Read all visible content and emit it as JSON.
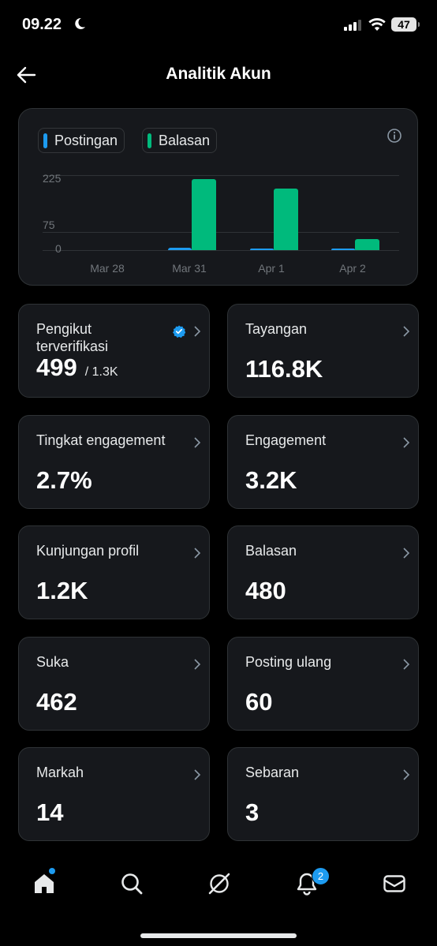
{
  "status_bar": {
    "time": "09.22",
    "battery": "47"
  },
  "header": {
    "title": "Analitik Akun"
  },
  "chart_data": {
    "type": "bar",
    "categories": [
      "Mar 28",
      "Mar 31",
      "Apr 1",
      "Apr 2"
    ],
    "series": [
      {
        "name": "Postingan",
        "values": [
          0,
          7,
          6,
          1
        ]
      },
      {
        "name": "Balasan",
        "values": [
          0,
          220,
          190,
          35
        ]
      }
    ],
    "y_ticks": [
      "225",
      "75",
      "0"
    ],
    "ylim": [
      0,
      225
    ],
    "colors": {
      "Postingan": "#1d9bf0",
      "Balasan": "#00ba7c"
    }
  },
  "legend": {
    "posts": "Postingan",
    "replies": "Balasan"
  },
  "stats": {
    "verified_followers": {
      "label": "Pengikut terverifikasi",
      "value": "499",
      "total": "/ 1.3K"
    },
    "impressions": {
      "label": "Tayangan",
      "value": "116.8K"
    },
    "engagement_rate": {
      "label": "Tingkat engagement",
      "value": "2.7%"
    },
    "engagements": {
      "label": "Engagement",
      "value": "3.2K"
    },
    "profile_visits": {
      "label": "Kunjungan profil",
      "value": "1.2K"
    },
    "replies": {
      "label": "Balasan",
      "value": "480"
    },
    "likes": {
      "label": "Suka",
      "value": "462"
    },
    "reposts": {
      "label": "Posting ulang",
      "value": "60"
    },
    "bookmarks": {
      "label": "Markah",
      "value": "14"
    },
    "shares": {
      "label": "Sebaran",
      "value": "3"
    }
  },
  "nav": {
    "notifications_badge": "2"
  },
  "icons": [
    "moon-icon",
    "signal-icon",
    "wifi-icon",
    "back-arrow-icon",
    "info-icon",
    "verified-badge-icon",
    "chevron-right-icon",
    "home-icon",
    "search-icon",
    "grok-icon",
    "bell-icon",
    "mail-icon"
  ]
}
